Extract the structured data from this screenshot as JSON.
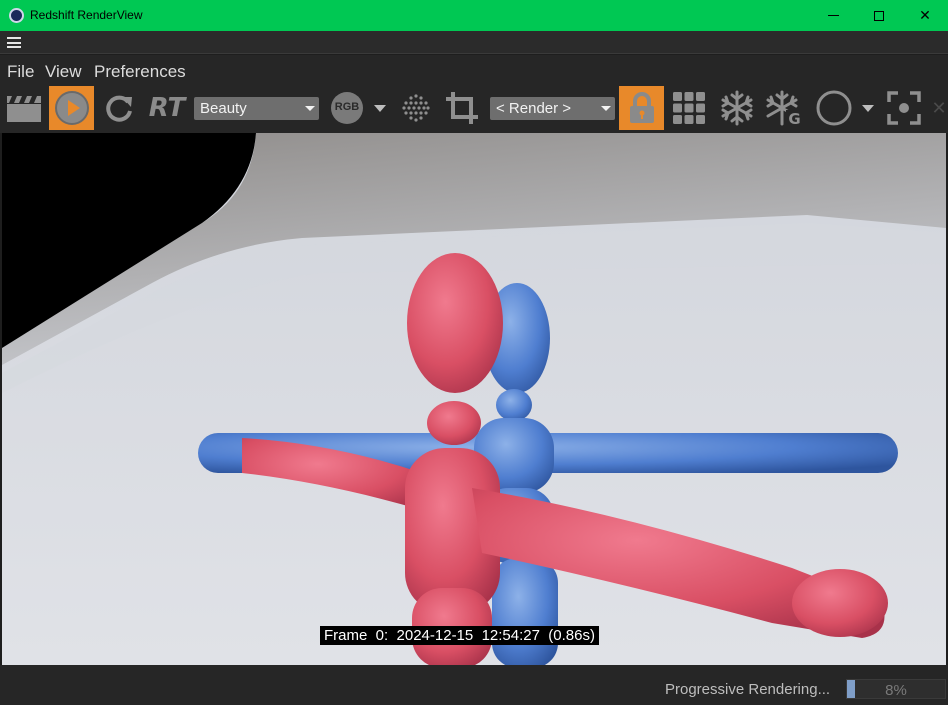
{
  "window": {
    "title": "Redshift RenderView",
    "minimize": "",
    "maximize": "",
    "close": "✕"
  },
  "menu": {
    "file": "File",
    "view": "View",
    "preferences": "Preferences"
  },
  "toolbar": {
    "rt_label": "RT",
    "aov_dropdown": "Beauty",
    "rgb_badge": "RGB",
    "camera_dropdown": "< Render >",
    "accent_color": "#e8892a"
  },
  "viewport": {
    "frame_info": "Frame  0:  2024-12-15  12:54:27  (0.86s)"
  },
  "status": {
    "text": "Progressive Rendering...",
    "progress_label": "8%",
    "progress_value": 0.08
  }
}
